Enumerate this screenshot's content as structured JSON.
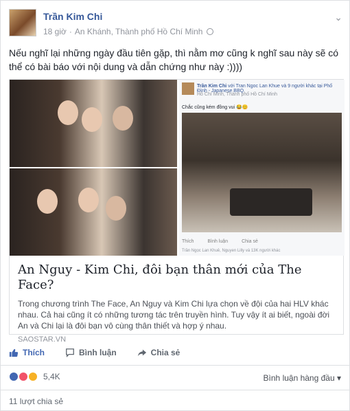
{
  "post": {
    "author": "Trần Kim Chi",
    "time": "18 giờ",
    "location": "An Khánh, Thành phố Hồ Chí Minh",
    "text": "Nếu nghĩ lại những ngày đầu tiên gặp, thì nằm mơ cũng k nghĩ sau này sẽ có thể có bài báo với nội dung và dẫn chứng như này :))))"
  },
  "link": {
    "embedded": {
      "author": "Trần Kim Chi",
      "with": "với Tran Ngoc Lan Khue và 9 người khác tại",
      "place": "Phố Đình - Japanese BBQ.",
      "sub": "Hồ Chí Minh, Thành phố Hồ Chí Minh",
      "caption": "Chắc cũng kém đồng vui 😂😊",
      "like": "Thích",
      "comment": "Bình luận",
      "share": "Chia sẻ",
      "footer": "Trần Ngọc Lan Khuê, Nguyen Lilly và 13K người khác"
    },
    "title": "An Nguy - Kim Chi, đôi bạn thân mới của The Face?",
    "description": "Trong chương trình The Face, An Nguy và Kim Chi lựa chọn về đội của hai HLV khác nhau. Cả hai cũng ít có những tương tác trên truyền hình. Tuy vậy ít ai biết, ngoài đời An và Chi lại là đôi bạn vô cùng thân thiết và hợp ý nhau.",
    "source": "SAOSTAR.VN"
  },
  "actions": {
    "like": "Thích",
    "comment": "Bình luận",
    "share": "Chia sẻ"
  },
  "stats": {
    "reactions": "5,4K",
    "sort": "Bình luận hàng đầu ▾",
    "shares": "11 lượt chia sẻ"
  },
  "colors": {
    "link": "#365899",
    "like": "#4267b2",
    "love": "#f25268",
    "haha": "#f7b125"
  },
  "icons": [
    "chevron-down-icon",
    "globe-icon",
    "like-icon",
    "comment-icon",
    "share-icon",
    "like-reaction-icon",
    "love-reaction-icon",
    "haha-reaction-icon"
  ]
}
